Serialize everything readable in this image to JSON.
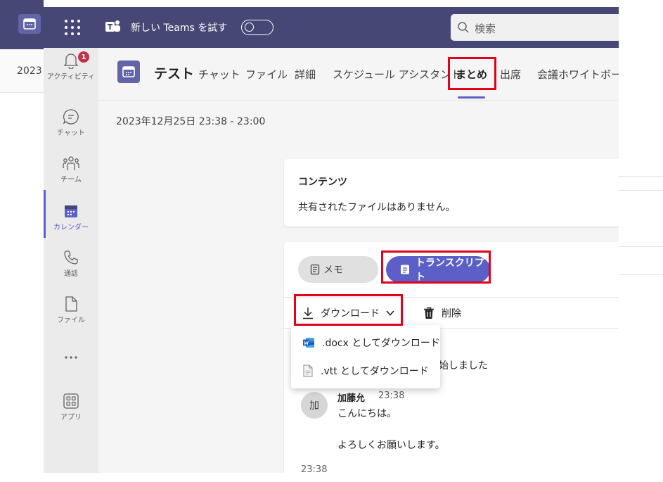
{
  "background_window": {
    "date_text": "2023"
  },
  "topbar": {
    "new_teams_label": "新しい Teams を試す",
    "search_placeholder": "検索"
  },
  "rail": {
    "items": [
      {
        "label": "アクティビティ",
        "icon": "bell-icon",
        "badge": "1"
      },
      {
        "label": "チャット",
        "icon": "chat-icon"
      },
      {
        "label": "チーム",
        "icon": "teams-icon"
      },
      {
        "label": "カレンダー",
        "icon": "calendar-icon",
        "active": true
      },
      {
        "label": "通話",
        "icon": "phone-icon"
      },
      {
        "label": "ファイル",
        "icon": "file-icon"
      },
      {
        "label": "",
        "icon": "more-icon"
      },
      {
        "label": "アプリ",
        "icon": "apps-icon"
      }
    ]
  },
  "meeting": {
    "title": "テスト",
    "tabs": [
      "チャット",
      "ファイル",
      "詳細",
      "スケジュール アシスタント",
      "まとめ",
      "出席",
      "会議ホワイトボード"
    ],
    "active_tab": "まとめ",
    "date": "2023年12月25日 23:38 - 23:00"
  },
  "content_card": {
    "title": "コンテンツ",
    "body": "共有されたファイルはありません。"
  },
  "transcript_card": {
    "memo_label": "メモ",
    "transcript_label": "トランスクリプト",
    "download_label": "ダウンロード",
    "delete_label": "削除",
    "partial_text": "始しました",
    "entry": {
      "avatar_initial": "加",
      "speaker": "加藤允",
      "time": "23:38",
      "line1": "こんにちは。",
      "line2": "よろしくお願いします。"
    },
    "bottom_time": "23:38"
  },
  "download_menu": {
    "items": [
      {
        "label": ".docx としてダウンロード",
        "icon": "word-icon"
      },
      {
        "label": ".vtt としてダウンロード",
        "icon": "document-icon"
      }
    ]
  },
  "colors": {
    "header_bg": "#464775",
    "accent": "#5b5fc7",
    "highlight_box": "#e3001b"
  }
}
